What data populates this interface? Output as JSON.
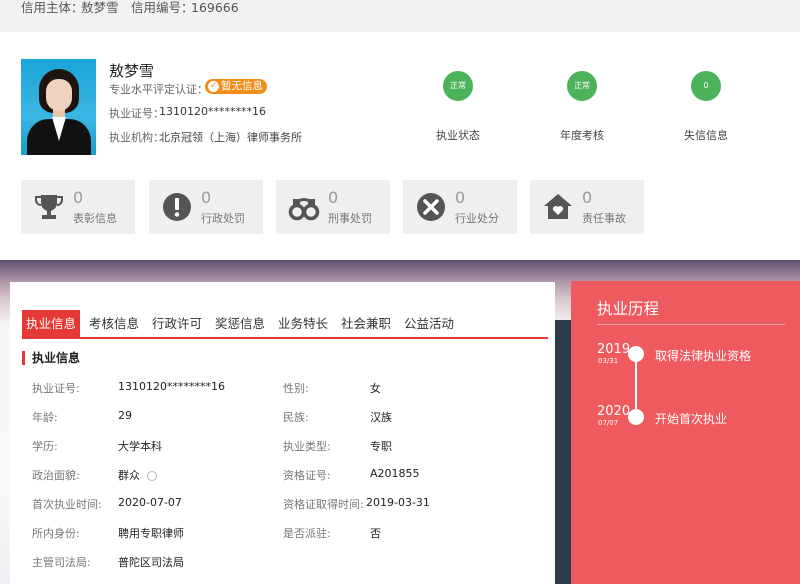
{
  "header": {
    "subject_label": "信用主体：",
    "subject_value": "敖梦雪",
    "code_label": "信用编号：",
    "code_value": "169666"
  },
  "profile": {
    "name": "敖梦雪",
    "cert_label": "专业水平评定认证：",
    "cert_badge": "暂无信息",
    "license_label": "执业证号：",
    "license_value": "1310120********16",
    "org_label": "执业机构：",
    "org_value": "北京冠领（上海）律师事务所"
  },
  "status": [
    {
      "value": "正常",
      "label": "执业状态"
    },
    {
      "value": "正常",
      "label": "年度考核"
    },
    {
      "value": "0",
      "label": "失信信息"
    }
  ],
  "tiles": [
    {
      "count": "0",
      "label": "表彰信息",
      "icon": "trophy-icon"
    },
    {
      "count": "0",
      "label": "行政处罚",
      "icon": "alert-icon"
    },
    {
      "count": "0",
      "label": "刑事处罚",
      "icon": "handcuffs-icon"
    },
    {
      "count": "0",
      "label": "行业处分",
      "icon": "close-circle-icon"
    },
    {
      "count": "0",
      "label": "责任事故",
      "icon": "house-icon"
    }
  ],
  "tabs": [
    "执业信息",
    "考核信息",
    "行政许可",
    "奖惩信息",
    "业务特长",
    "社会兼职",
    "公益活动"
  ],
  "section_title": "执业信息",
  "fields": {
    "license": {
      "label": "执业证号:",
      "value": "1310120********16"
    },
    "gender": {
      "label": "性别:",
      "value": "女"
    },
    "age": {
      "label": "年龄:",
      "value": "29"
    },
    "ethnicity": {
      "label": "民族:",
      "value": "汉族"
    },
    "education": {
      "label": "学历:",
      "value": "大学本科"
    },
    "practice_type": {
      "label": "执业类型:",
      "value": "专职"
    },
    "political": {
      "label": "政治面貌:",
      "value": "群众"
    },
    "qualification": {
      "label": "资格证号:",
      "value": "A201855"
    },
    "first_practice": {
      "label": "首次执业时间:",
      "value": "2020-07-07"
    },
    "qual_date": {
      "label": "资格证取得时间:",
      "value": "2019-03-31"
    },
    "identity": {
      "label": "所内身份:",
      "value": "聘用专职律师"
    },
    "stationed": {
      "label": "是否派驻:",
      "value": "否"
    },
    "authority": {
      "label": "主管司法局:",
      "value": "普陀区司法局"
    }
  },
  "history": {
    "title": "执业历程",
    "events": [
      {
        "year": "2019",
        "date": "03/31",
        "text": "取得法律执业资格"
      },
      {
        "year": "2020",
        "date": "07/07",
        "text": "开始首次执业"
      }
    ]
  },
  "colors": {
    "accent_red": "#e53935",
    "history_bg": "#ee5a5d",
    "status_green": "#4cb35a",
    "badge_orange": "#f28c1b"
  }
}
